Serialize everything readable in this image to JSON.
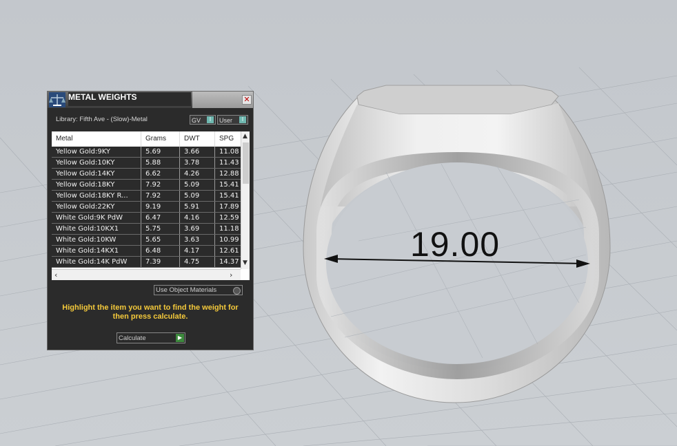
{
  "viewport": {
    "dimension_label": "19.00"
  },
  "panel": {
    "title": "METAL WEIGHTS",
    "close_glyph": "✕",
    "library_label": "Library: Fifth Ave - (Slow)-Metal",
    "toggles": {
      "gv": "GV",
      "user": "User",
      "knob_glyph": "I"
    },
    "table": {
      "columns": [
        "Metal",
        "Grams",
        "DWT",
        "SPG"
      ],
      "rows": [
        [
          "Yellow Gold:9KY",
          "5.69",
          "3.66",
          "11.08"
        ],
        [
          "Yellow Gold:10KY",
          "5.88",
          "3.78",
          "11.43"
        ],
        [
          "Yellow Gold:14KY",
          "6.62",
          "4.26",
          "12.88"
        ],
        [
          "Yellow Gold:18KY",
          "7.92",
          "5.09",
          "15.41"
        ],
        [
          "Yellow Gold:18KY R...",
          "7.92",
          "5.09",
          "15.41"
        ],
        [
          "Yellow Gold:22KY",
          "9.19",
          "5.91",
          "17.89"
        ],
        [
          "White Gold:9K PdW",
          "6.47",
          "4.16",
          "12.59"
        ],
        [
          "White Gold:10KX1",
          "5.75",
          "3.69",
          "11.18"
        ],
        [
          "White Gold:10KW",
          "5.65",
          "3.63",
          "10.99"
        ],
        [
          "White Gold:14KX1",
          "6.48",
          "4.17",
          "12.61"
        ],
        [
          "White Gold:14K PdW",
          "7.39",
          "4.75",
          "14.37"
        ]
      ]
    },
    "use_object_materials": "Use Object Materials",
    "instruction": "Highlight the item you want to find the weight for then press calculate.",
    "calculate_label": "Calculate",
    "calculate_glyph": "▶"
  },
  "icons": {
    "logo": "scale-logo-icon",
    "close": "close-icon",
    "scroll_up": "scroll-up-icon",
    "scroll_down": "scroll-down-icon",
    "scroll_left": "scroll-left-icon",
    "scroll_right": "scroll-right-icon"
  },
  "colors": {
    "panel_bg": "#2b2b2b",
    "instruction_text": "#f4c93b",
    "toggle_knob": "#6fb8b0",
    "calculate_arrow": "#3d8a3d"
  }
}
